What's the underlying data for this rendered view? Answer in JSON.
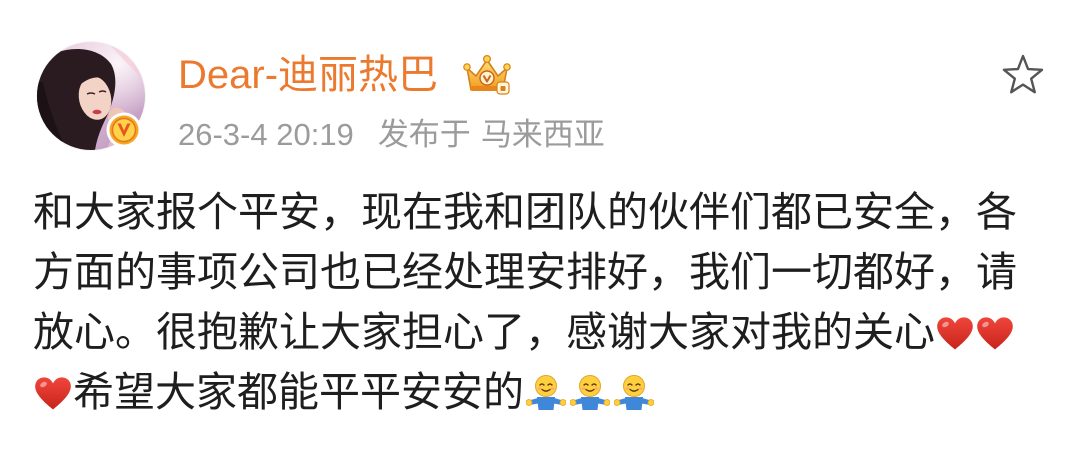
{
  "post": {
    "author": {
      "name": "Dear-迪丽热巴"
    },
    "meta": {
      "time": "26-3-4 20:19",
      "published_from": "发布于",
      "location": "马来西亚"
    },
    "content": {
      "text_1": "和大家报个平安，现在我和团队的伙伴们都已安全，各方面的事项公司也已经处理安排好，我们一切都好，请放心。很抱歉让大家担心了，感谢大家对我的关心",
      "emoji_1": [
        "red-heart-icon",
        "red-heart-icon",
        "red-heart-icon"
      ],
      "text_2": "希望大家都能平平安安的",
      "emoji_2": [
        "hug-emoji-icon",
        "hug-emoji-icon",
        "hug-emoji-icon"
      ]
    }
  },
  "icons": {
    "avatar": "avatar-photo",
    "verified": "verified-v-icon",
    "member_badge": "vip-crown-icon",
    "favorite": "star-icon"
  },
  "colors": {
    "author_name": "#eb7a2f",
    "meta_text": "#9b9b9b",
    "body_text": "#1e1e1e",
    "heart": "#e0312b",
    "verified_badge": "#f5a623",
    "hug_emoji_body": "#3f88d9"
  }
}
